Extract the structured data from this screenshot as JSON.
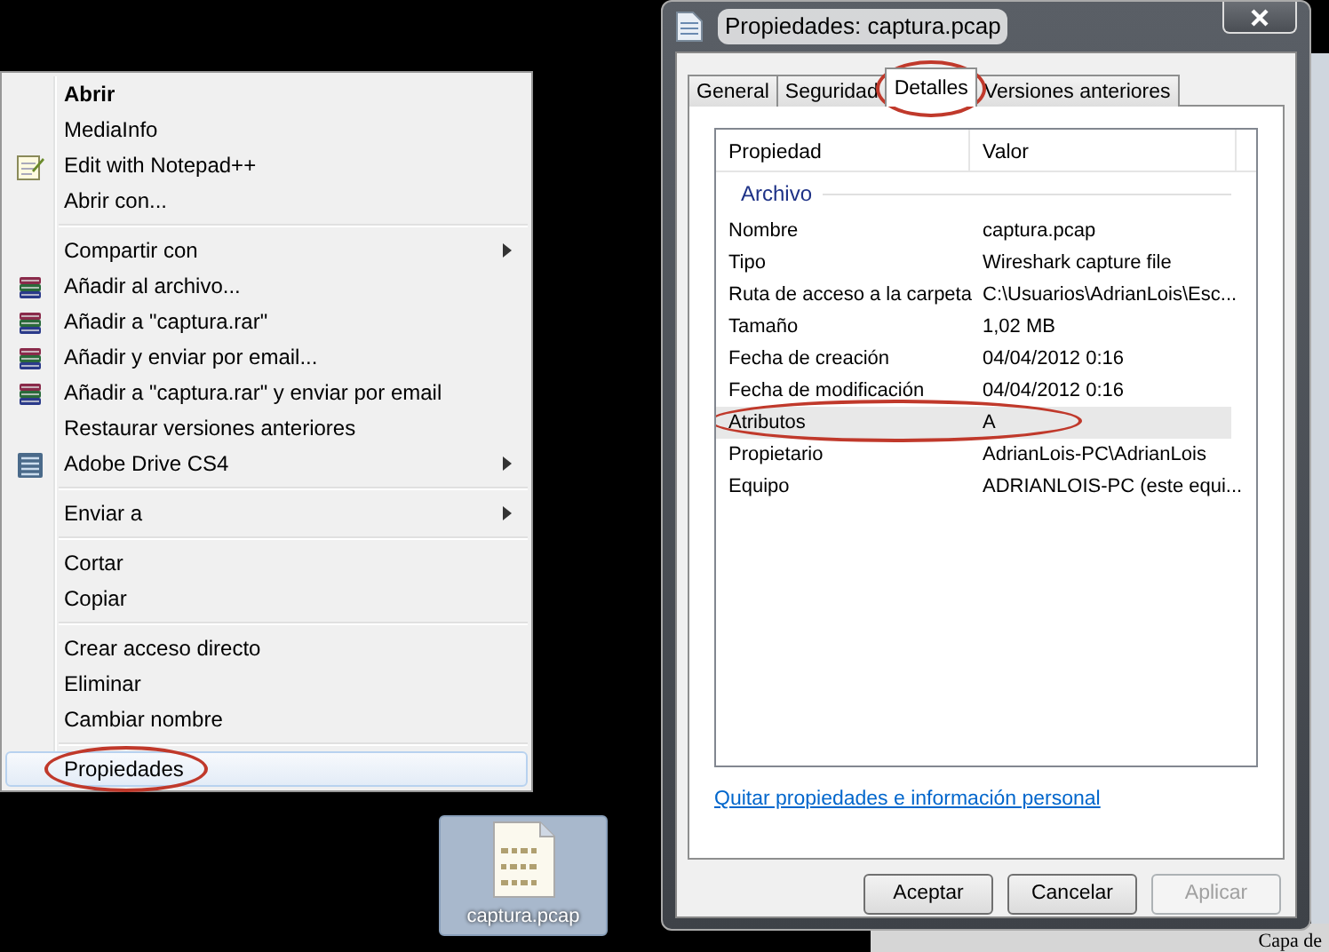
{
  "context_menu": {
    "groups": [
      [
        {
          "label": "Abrir",
          "bold": true,
          "kind": "plain",
          "submenu": false,
          "selected": false,
          "circled": false
        },
        {
          "label": "MediaInfo",
          "bold": false,
          "kind": "plain",
          "submenu": false,
          "selected": false,
          "circled": false
        },
        {
          "label": "Edit with Notepad++",
          "bold": false,
          "kind": "notepad",
          "submenu": false,
          "selected": false,
          "circled": false
        },
        {
          "label": "Abrir con...",
          "bold": false,
          "kind": "plain",
          "submenu": false,
          "selected": false,
          "circled": false
        }
      ],
      [
        {
          "label": "Compartir con",
          "bold": false,
          "kind": "plain",
          "submenu": true,
          "selected": false,
          "circled": false
        },
        {
          "label": "Añadir al archivo...",
          "bold": false,
          "kind": "archive",
          "submenu": false,
          "selected": false,
          "circled": false
        },
        {
          "label": "Añadir a \"captura.rar\"",
          "bold": false,
          "kind": "archive",
          "submenu": false,
          "selected": false,
          "circled": false
        },
        {
          "label": "Añadir y enviar por email...",
          "bold": false,
          "kind": "archive",
          "submenu": false,
          "selected": false,
          "circled": false
        },
        {
          "label": "Añadir a \"captura.rar\" y enviar por email",
          "bold": false,
          "kind": "archive",
          "submenu": false,
          "selected": false,
          "circled": false
        },
        {
          "label": "Restaurar versiones anteriores",
          "bold": false,
          "kind": "plain",
          "submenu": false,
          "selected": false,
          "circled": false
        },
        {
          "label": "Adobe Drive CS4",
          "bold": false,
          "kind": "drive",
          "submenu": true,
          "selected": false,
          "circled": false
        }
      ],
      [
        {
          "label": "Enviar a",
          "bold": false,
          "kind": "plain",
          "submenu": true,
          "selected": false,
          "circled": false
        }
      ],
      [
        {
          "label": "Cortar",
          "bold": false,
          "kind": "plain",
          "submenu": false,
          "selected": false,
          "circled": false
        },
        {
          "label": "Copiar",
          "bold": false,
          "kind": "plain",
          "submenu": false,
          "selected": false,
          "circled": false
        }
      ],
      [
        {
          "label": "Crear acceso directo",
          "bold": false,
          "kind": "plain",
          "submenu": false,
          "selected": false,
          "circled": false
        },
        {
          "label": "Eliminar",
          "bold": false,
          "kind": "plain",
          "submenu": false,
          "selected": false,
          "circled": false
        },
        {
          "label": "Cambiar nombre",
          "bold": false,
          "kind": "plain",
          "submenu": false,
          "selected": false,
          "circled": false
        }
      ],
      [
        {
          "label": "Propiedades",
          "bold": false,
          "kind": "plain",
          "submenu": false,
          "selected": true,
          "circled": true
        }
      ]
    ]
  },
  "desktop_icon": {
    "label": "captura.pcap",
    "selected": true
  },
  "dialog": {
    "title": "Propiedades: captura.pcap",
    "tabs": [
      {
        "label": "General",
        "selected": false,
        "circled": false
      },
      {
        "label": "Seguridad",
        "selected": false,
        "circled": false
      },
      {
        "label": "Detalles",
        "selected": true,
        "circled": true
      },
      {
        "label": "Versiones anteriores",
        "selected": false,
        "circled": false
      }
    ],
    "table": {
      "columns": [
        "Propiedad",
        "Valor"
      ],
      "group": "Archivo",
      "rows": [
        {
          "cells": [
            "Nombre",
            "captura.pcap"
          ],
          "selected": false,
          "circled": false
        },
        {
          "cells": [
            "Tipo",
            "Wireshark capture file"
          ],
          "selected": false,
          "circled": false
        },
        {
          "cells": [
            "Ruta de acceso a la carpeta",
            "C:\\Usuarios\\AdrianLois\\Esc..."
          ],
          "selected": false,
          "circled": false
        },
        {
          "cells": [
            "Tamaño",
            "1,02 MB"
          ],
          "selected": false,
          "circled": false
        },
        {
          "cells": [
            "Fecha de creación",
            "04/04/2012 0:16"
          ],
          "selected": false,
          "circled": false
        },
        {
          "cells": [
            "Fecha de modificación",
            "04/04/2012 0:16"
          ],
          "selected": false,
          "circled": false
        },
        {
          "cells": [
            "Atributos",
            "A"
          ],
          "selected": true,
          "circled": true
        },
        {
          "cells": [
            "Propietario",
            "AdrianLois-PC\\AdrianLois"
          ],
          "selected": false,
          "circled": false
        },
        {
          "cells": [
            "Equipo",
            "ADRIANLOIS-PC (este equi..."
          ],
          "selected": false,
          "circled": false
        }
      ]
    },
    "link": "Quitar propiedades e información personal",
    "buttons": [
      {
        "label": "Aceptar",
        "disabled": false
      },
      {
        "label": "Cancelar",
        "disabled": false
      },
      {
        "label": "Aplicar",
        "disabled": true
      }
    ]
  },
  "background_text": "Capa de"
}
